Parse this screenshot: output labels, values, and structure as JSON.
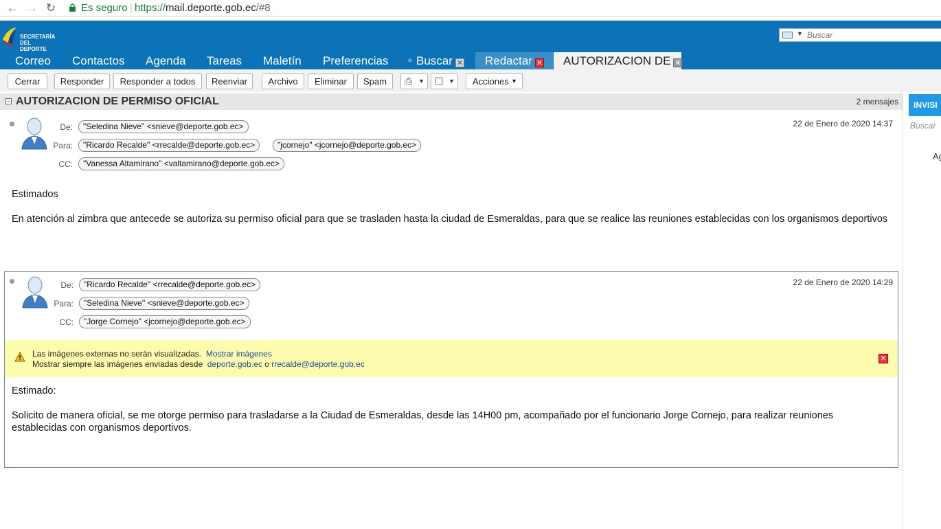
{
  "browser": {
    "secure_label": "Es seguro",
    "url_scheme": "https://",
    "url_host": "mail.deporte.gob.ec",
    "url_path": "/#8"
  },
  "header": {
    "logo_line1": "SECRETARÍA",
    "logo_line2": "DEL DEPORTE",
    "search_placeholder": "Buscar",
    "tabs": [
      {
        "label": "Correo"
      },
      {
        "label": "Contactos"
      },
      {
        "label": "Agenda"
      },
      {
        "label": "Tareas"
      },
      {
        "label": "Maletín"
      },
      {
        "label": "Preferencias"
      },
      {
        "label": "Buscar"
      },
      {
        "label": "Redactar"
      },
      {
        "label": "AUTORIZACION DE"
      }
    ]
  },
  "toolbar": {
    "close": "Cerrar",
    "reply": "Responder",
    "reply_all": "Responder a todos",
    "forward": "Reenviar",
    "archive": "Archivo",
    "delete": "Eliminar",
    "spam": "Spam",
    "actions": "Acciones"
  },
  "conversation": {
    "title": "AUTORIZACION DE PERMISO OFICIAL",
    "count": "2 mensajes",
    "labels": {
      "from": "De:",
      "to": "Para:",
      "cc": "CC:"
    },
    "messages": [
      {
        "from": "\"Seledina Nieve\" <snieve@deporte.gob.ec>",
        "to": [
          "\"Ricardo Recalde\" <rrecalde@deporte.gob.ec>",
          "\"jcornejo\" <jcornejo@deporte.gob.ec>"
        ],
        "cc": "\"Vanessa Altamirano\" <valtamirano@deporte.gob.ec>",
        "date": "22 de Enero de 2020 14:37",
        "greeting": "Estimados",
        "body": "En atención al zimbra que antecede se autoriza su permiso oficial para que se trasladen hasta la ciudad de Esmeraldas, para que se realice las reuniones establecidas con los organismos deportivos"
      },
      {
        "from": "\"Ricardo Recalde\" <rrecalde@deporte.gob.ec>",
        "to": "\"Seledina Nieve\" <snieve@deporte.gob.ec>",
        "cc": "\"Jorge Cornejo\" <jcornejo@deporte.gob.ec>",
        "date": "22 de Enero de 2020 14:29",
        "warning_line1": "Las imágenes externas no serán visualizadas.",
        "warning_show": "Mostrar imágenes",
        "warning_line2": "Mostrar siempre las imágenes enviadas desde",
        "warning_domain": "deporte.gob.ec",
        "warning_or": "o",
        "warning_sender": "rrecalde@deporte.gob.ec",
        "greeting": "Estimado:",
        "body": "Solicito de manera oficial, se me otorge permiso para trasladarse a la Ciudad de Esmeraldas, desde las 14H00 pm, acompañado por el funcionario Jorge Cornejo, para realizar reuniones establecidas con organismos deportivos."
      }
    ]
  },
  "sidebar": {
    "invite_label": "INVISI",
    "search_label": "Buscar",
    "ag_label": "Ag"
  },
  "colors": {
    "header_bg": "#0c73b8",
    "secure_green": "#188038",
    "warning_bg": "#fdfbae",
    "invite_blue": "#1e9be8"
  }
}
